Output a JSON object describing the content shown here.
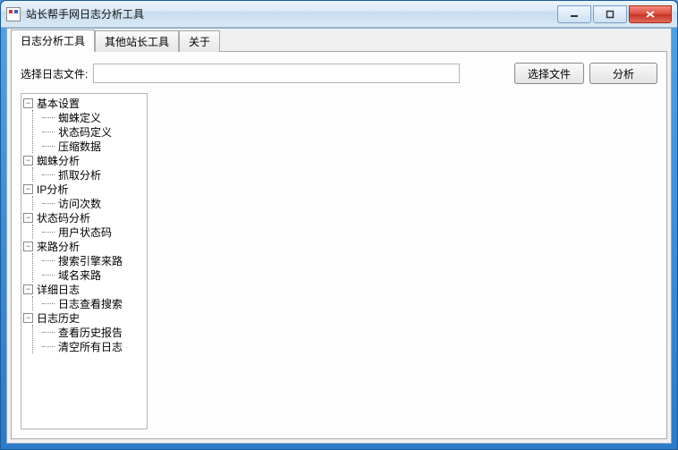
{
  "window": {
    "title": "站长帮手网日志分析工具"
  },
  "tabs": [
    {
      "label": "日志分析工具",
      "active": true
    },
    {
      "label": "其他站长工具",
      "active": false
    },
    {
      "label": "关于",
      "active": false
    }
  ],
  "toolbar": {
    "select_log_label": "选择日志文件:",
    "filepath_value": "",
    "choose_file_button": "选择文件",
    "analyze_button": "分析"
  },
  "tree": [
    {
      "label": "基本设置",
      "children": [
        {
          "label": "蜘蛛定义"
        },
        {
          "label": "状态码定义"
        },
        {
          "label": "压缩数据"
        }
      ]
    },
    {
      "label": "蜘蛛分析",
      "children": [
        {
          "label": "抓取分析"
        }
      ]
    },
    {
      "label": "IP分析",
      "children": [
        {
          "label": "访问次数"
        }
      ]
    },
    {
      "label": "状态码分析",
      "children": [
        {
          "label": "用户状态码"
        }
      ]
    },
    {
      "label": "来路分析",
      "children": [
        {
          "label": "搜索引擎来路"
        },
        {
          "label": "域名来路"
        }
      ]
    },
    {
      "label": "详细日志",
      "children": [
        {
          "label": "日志查看搜索"
        }
      ]
    },
    {
      "label": "日志历史",
      "children": [
        {
          "label": "查看历史报告"
        },
        {
          "label": "清空所有日志"
        }
      ]
    }
  ]
}
